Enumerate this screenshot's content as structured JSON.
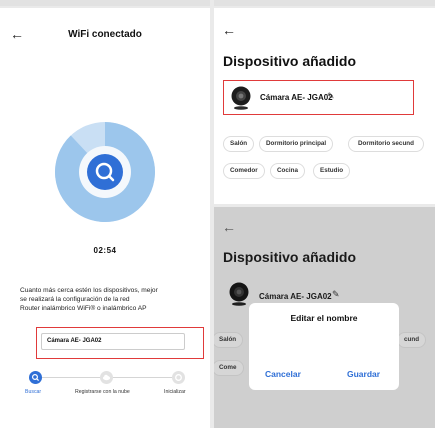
{
  "left": {
    "title": "WiFi conectado",
    "back": "←",
    "timer": "02:54",
    "description": [
      "Cuanto más cerca estén los dispositivos, mejor",
      "se realizará la configuración de la red",
      "Router inalámbrico WiFi® o inalámbrico AP"
    ],
    "progress": 0.88,
    "steps": [
      {
        "label": "Buscar",
        "active": true
      },
      {
        "label": "Registrarse con la nube",
        "active": false
      },
      {
        "label": "Inicializar",
        "active": false
      }
    ]
  },
  "added": {
    "back": "←",
    "title": "Dispositivo añadido",
    "device_name": "Cámara AE-  JGA02",
    "edit": "✎",
    "rooms": [
      "Salón",
      "Dormitorio principal",
      "Dormitorio secund",
      "Comedor",
      "Cocina",
      "Estudio"
    ]
  },
  "dialog_view": {
    "back": "←",
    "title": "Dispositivo añadido",
    "device_name": "Cámara AE-  JGA02",
    "edit": "✎",
    "chip_left_1": "Salón",
    "chip_right_1": "cund",
    "chip_left_2": "Come",
    "dialog_title": "Editar el nombre",
    "input_value": "Cámara AE-  JGA02",
    "cancel": "Cancelar",
    "save": "Guardar"
  },
  "colors": {
    "accent": "#2f6fd6",
    "highlight": "#e03a3a",
    "ring_light": "#c9dff4",
    "ring_mid": "#9cc6ec"
  }
}
